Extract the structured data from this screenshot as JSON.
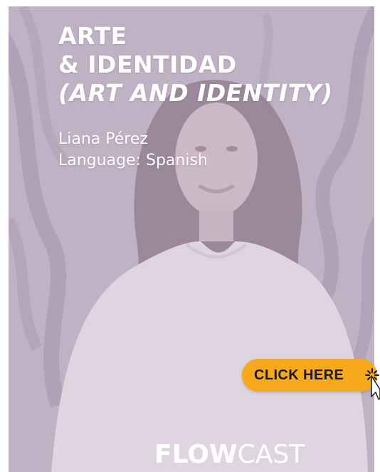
{
  "promo": {
    "title_line1": "ARTE",
    "title_line2": "& IDENTIDAD",
    "title_translation": "(ART AND IDENTITY)",
    "speaker": "Liana Pérez",
    "language": "Language: Spanish"
  },
  "cta": {
    "label": "CLICK HERE",
    "color": "#f7a81b"
  },
  "brand": {
    "part1": "FLOW",
    "part2": "CAST"
  },
  "icons": {
    "sparkle": "sparkle-icon",
    "cursor": "pointer-cursor-icon"
  }
}
